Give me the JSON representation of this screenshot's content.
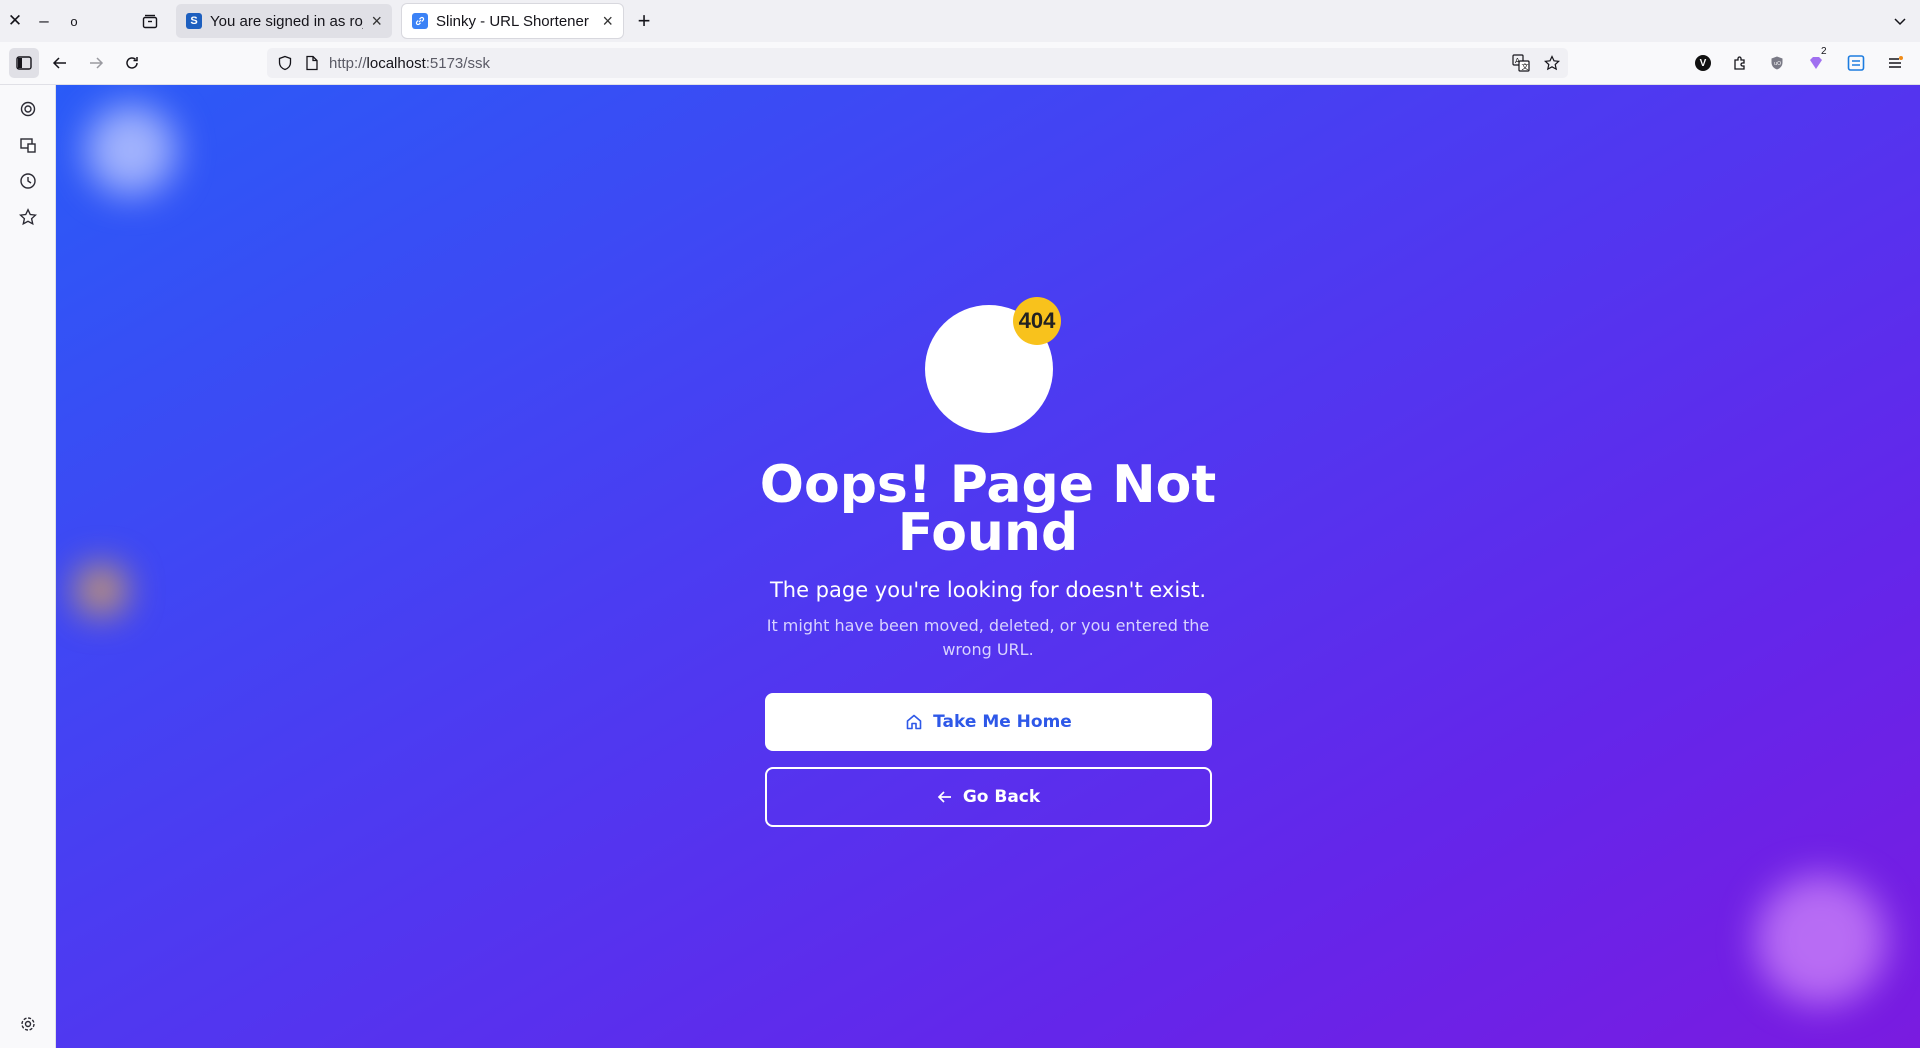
{
  "tabs": [
    {
      "title": "You are signed in as rojith",
      "favicon": "S",
      "active": false
    },
    {
      "title": "Slinky - URL Shortener",
      "favicon": "link-icon",
      "active": true
    }
  ],
  "window_controls": [
    "close-icon",
    "minimize-icon",
    "restore-icon"
  ],
  "urlbar": {
    "prefix": "http://",
    "host": "localhost",
    "rest": ":5173/ssk"
  },
  "extensions": {
    "badge_count": "2",
    "v_label": "V"
  },
  "page": {
    "badge": "404",
    "heading": "Oops! Page Not Found",
    "subtitle": "The page you're looking for doesn't exist.",
    "description": "It might have been moved, deleted, or you entered the wrong URL.",
    "home_button": "Take Me Home",
    "back_button": "Go Back"
  },
  "colors": {
    "gradient_start": "#2a5bf7",
    "gradient_end": "#7a1be0",
    "badge": "#f8c21c",
    "home_text": "#2e58e8"
  }
}
